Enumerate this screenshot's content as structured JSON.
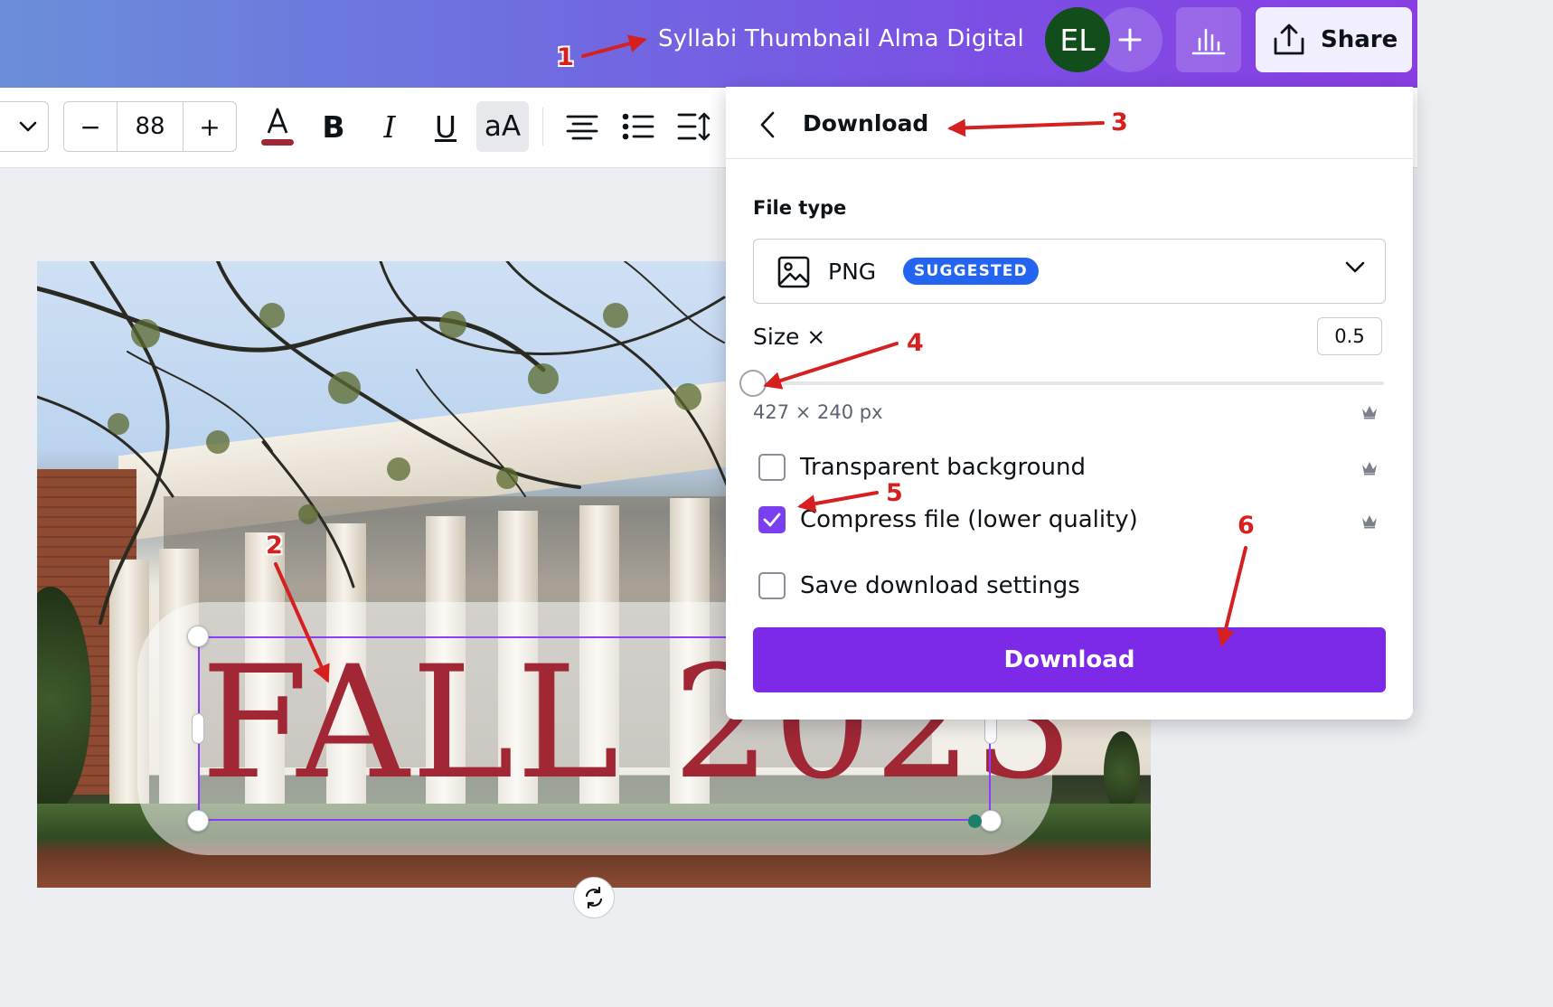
{
  "topbar": {
    "doc_title": "Syllabi Thumbnail Alma Digital",
    "avatar_initials": "EL",
    "add_icon": "plus-icon",
    "stats_icon": "bar-chart-icon",
    "share_label": "Share",
    "share_icon": "upload-icon"
  },
  "toolbar": {
    "font_size": "88",
    "decrease_label": "−",
    "increase_label": "+",
    "bold_label": "B",
    "italic_label": "I",
    "underline_label": "U",
    "case_label": "aA",
    "text_color": "#a02733"
  },
  "canvas": {
    "headline": "FALL 2023",
    "headline_color": "#a02733",
    "selection_color": "#8b3dff"
  },
  "download_panel": {
    "title": "Download",
    "file_type_label": "File type",
    "file_type_value": "PNG",
    "file_type_badge": "SUGGESTED",
    "size_label": "Size ×",
    "size_value": "0.5",
    "size_slider_fraction": 0,
    "dimensions_text": "427 × 240 px",
    "options": [
      {
        "label": "Transparent background",
        "checked": false,
        "pro": true
      },
      {
        "label": "Compress file (lower quality)",
        "checked": true,
        "pro": true
      },
      {
        "label": "Save download settings",
        "checked": false,
        "pro": false
      }
    ],
    "download_button": "Download",
    "accent_color": "#7d2ae8",
    "badge_color": "#2364f0"
  },
  "annotations": [
    "1",
    "2",
    "3",
    "4",
    "5",
    "6"
  ]
}
